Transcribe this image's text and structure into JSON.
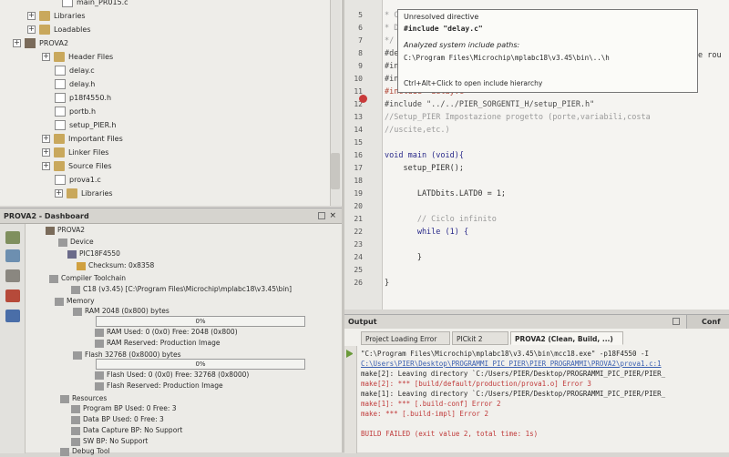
{
  "projects": {
    "tree": [
      {
        "label": "main_PR015.c",
        "kind": "file"
      },
      {
        "label": "Libraries",
        "kind": "folder"
      },
      {
        "label": "Loadables",
        "kind": "folder"
      },
      {
        "label": "PROVA2",
        "kind": "project"
      },
      {
        "label": "Header Files",
        "kind": "folder"
      },
      {
        "label": "delay.c",
        "kind": "file"
      },
      {
        "label": "delay.h",
        "kind": "file"
      },
      {
        "label": "p18f4550.h",
        "kind": "file"
      },
      {
        "label": "portb.h",
        "kind": "file"
      },
      {
        "label": "setup_PIER.h",
        "kind": "file"
      },
      {
        "label": "Important Files",
        "kind": "folder"
      },
      {
        "label": "Linker Files",
        "kind": "folder"
      },
      {
        "label": "Source Files",
        "kind": "folder"
      },
      {
        "label": "prova1.c",
        "kind": "file"
      },
      {
        "label": "Libraries",
        "kind": "folder"
      }
    ]
  },
  "dashboard": {
    "title": "PROVA2 - Dashboard",
    "rows": [
      {
        "label": "PROVA2"
      },
      {
        "label": "Device"
      },
      {
        "label": "PIC18F4550"
      },
      {
        "label": "Checksum: 0x8358"
      },
      {
        "label": "Compiler Toolchain"
      },
      {
        "label": "C18 (v3.45) [C:\\Program Files\\Microchip\\mplabc18\\v3.45\\bin]"
      },
      {
        "label": "Memory"
      },
      {
        "label": "RAM 2048 (0x800) bytes"
      },
      {
        "label": "RAM Used: 0 (0x0) Free: 2048 (0x800)"
      },
      {
        "label": "RAM Reserved: Production Image"
      },
      {
        "label": "Flash 32768 (0x8000) bytes"
      },
      {
        "label": "Flash Used: 0 (0x0) Free: 32768 (0x8000)"
      },
      {
        "label": "Flash Reserved: Production Image"
      },
      {
        "label": "Resources"
      },
      {
        "label": "Program BP Used: 0 Free: 3"
      },
      {
        "label": "Data BP Used: 0 Free: 3"
      },
      {
        "label": "Data Capture BP: No Support"
      },
      {
        "label": "SW BP: No Support"
      },
      {
        "label": "Debug Tool"
      }
    ],
    "ram_bar": {
      "label": "0%",
      "percent": 0
    },
    "flash_bar": {
      "label": "0%",
      "percent": 0
    }
  },
  "editor": {
    "lines": [
      {
        "n": "5",
        "text": "* Cre"
      },
      {
        "n": "6",
        "text": "* Des"
      },
      {
        "n": "7",
        "text": "*/"
      },
      {
        "n": "8",
        "text": "#defin"
      },
      {
        "n": "9",
        "text": "#inclu"
      },
      {
        "n": "10",
        "text": "#inclu"
      },
      {
        "n": "11",
        "text": "#include \"delay.c\""
      },
      {
        "n": "12",
        "text": "#include \"../../PIER_SORGENTI_H/setup_PIER.h\""
      },
      {
        "n": "13",
        "text": "//Setup_PIER Impostazione progetto (porte,variabili,costa"
      },
      {
        "n": "14",
        "text": "//uscite,etc.)"
      },
      {
        "n": "15",
        "text": ""
      },
      {
        "n": "16",
        "text": "void main (void){"
      },
      {
        "n": "17",
        "text": "    setup_PIER();"
      },
      {
        "n": "18",
        "text": ""
      },
      {
        "n": "19",
        "text": "       LATDbits.LATD0 = 1;"
      },
      {
        "n": "20",
        "text": ""
      },
      {
        "n": "21",
        "text": "       // Ciclo infinito"
      },
      {
        "n": "22",
        "text": "       while (1) {"
      },
      {
        "n": "23",
        "text": ""
      },
      {
        "n": "24",
        "text": "       }"
      },
      {
        "n": "25",
        "text": ""
      },
      {
        "n": "26",
        "text": "}"
      }
    ],
    "right_fragment": "e rou"
  },
  "tooltip": {
    "title": "Unresolved directive",
    "directive": "#include \"delay.c\"",
    "paths_label": "Analyzed system include paths:",
    "path": "C:\\Program Files\\Microchip\\mplabc18\\v3.45\\bin\\..\\h",
    "hint": "Ctrl+Alt+Click to open include hierarchy"
  },
  "output": {
    "title": "Output",
    "tabs": [
      {
        "label": "Project Loading Error"
      },
      {
        "label": "PICkit 2"
      },
      {
        "label": "PROVA2 (Clean, Build, ...)"
      }
    ],
    "side_tab": "Conf",
    "lines": [
      {
        "text": "\"C:\\Program Files\\Microchip\\mplabc18\\v3.45\\bin\\mcc18.exe\"   -p18F4550    -I",
        "kind": "normal"
      },
      {
        "text": "C:\\Users\\PIER\\Desktop\\PROGRAMMI_PIC_PIER\\PIER_PROGRAMMI\\PROVA2\\prova1.c:1",
        "kind": "link"
      },
      {
        "text": "make[2]: Leaving directory `C:/Users/PIER/Desktop/PROGRAMMI_PIC_PIER/PIER_",
        "kind": "normal"
      },
      {
        "text": "make[2]: *** [build/default/production/prova1.o] Error 3",
        "kind": "err"
      },
      {
        "text": "make[1]: Leaving directory `C:/Users/PIER/Desktop/PROGRAMMI_PIC_PIER/PIER_",
        "kind": "normal"
      },
      {
        "text": "make[1]: *** [.build-conf] Error 2",
        "kind": "err"
      },
      {
        "text": "make: *** [.build-impl] Error 2",
        "kind": "err"
      },
      {
        "text": "",
        "kind": "normal"
      },
      {
        "text": "BUILD FAILED (exit value 2, total time: 1s)",
        "kind": "err"
      }
    ]
  }
}
